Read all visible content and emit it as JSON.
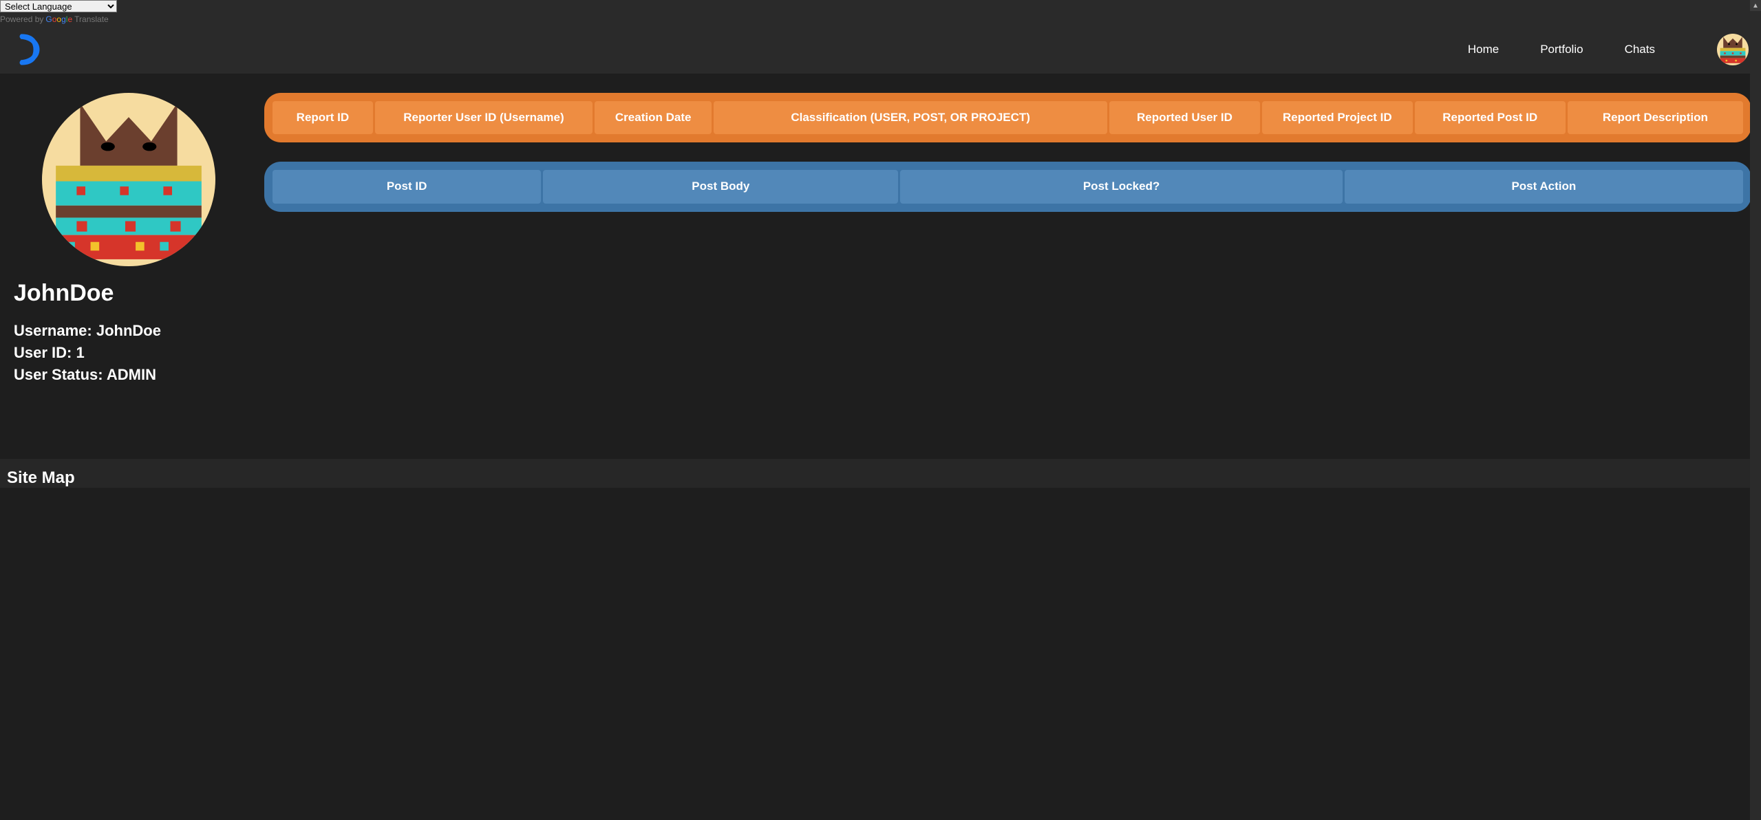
{
  "language_bar": {
    "select_value": "Select Language",
    "powered_by_text": "Powered by",
    "translate_text": "Translate"
  },
  "nav": {
    "items": [
      {
        "label": "Home"
      },
      {
        "label": "Portfolio"
      },
      {
        "label": "Chats"
      }
    ]
  },
  "profile": {
    "display_name": "JohnDoe",
    "username_line": "Username: JohnDoe",
    "user_id_line": "User ID: 1",
    "user_status_line": "User Status: ADMIN"
  },
  "reports_table": {
    "headers": [
      "Report ID",
      "Reporter User ID (Username)",
      "Creation Date",
      "Classification (USER, POST, OR PROJECT)",
      "Reported User ID",
      "Reported Project ID",
      "Reported Post ID",
      "Report Description"
    ]
  },
  "posts_table": {
    "headers": [
      "Post ID",
      "Post Body",
      "Post Locked?",
      "Post Action"
    ]
  },
  "footer": {
    "title": "Site Map"
  }
}
